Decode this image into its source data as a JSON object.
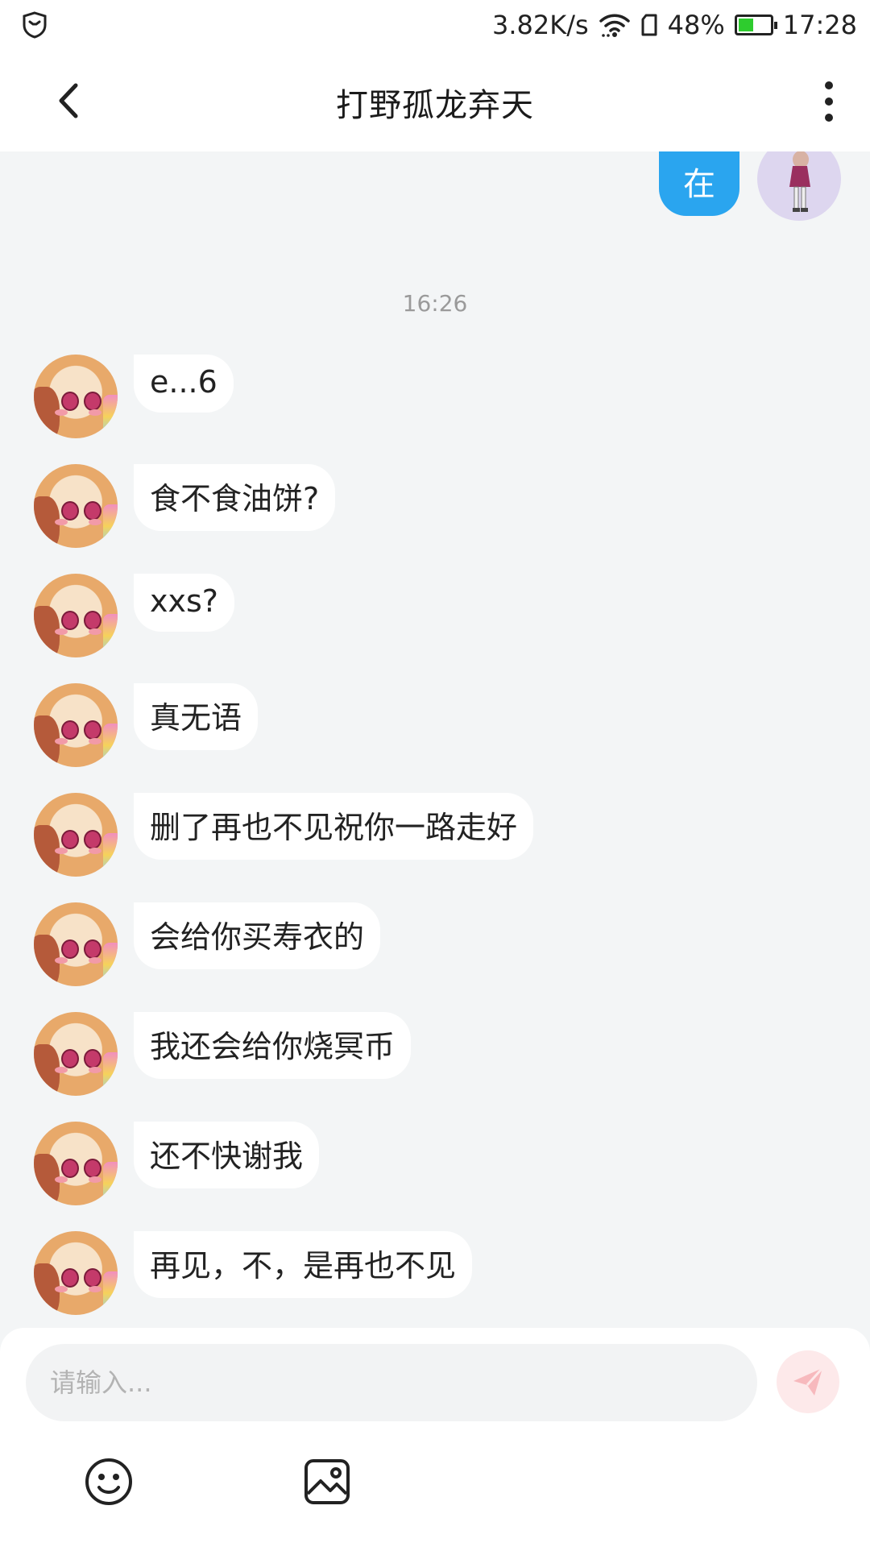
{
  "status_bar": {
    "net_speed": "3.82K/s",
    "battery_percent": "48%",
    "battery_level": 0.48,
    "time": "17:28",
    "icons": [
      "shield-icon",
      "wifi-icon",
      "sim-icon",
      "battery-icon"
    ]
  },
  "header": {
    "title": "打野孤龙弃天",
    "back_icon": "chevron-left-icon",
    "more_icon": "more-vertical-icon"
  },
  "chat": {
    "outgoing": {
      "text": "在"
    },
    "timestamp": "16:26",
    "incoming": [
      {
        "text": "e...6"
      },
      {
        "text": "食不食油饼?"
      },
      {
        "text": "xxs?"
      },
      {
        "text": "真无语"
      },
      {
        "text": "删了再也不见祝你一路走好"
      },
      {
        "text": "会给你买寿衣的"
      },
      {
        "text": "我还会给你烧冥币"
      },
      {
        "text": "还不快谢我"
      },
      {
        "text": "再见，不，是再也不见"
      }
    ]
  },
  "composer": {
    "placeholder": "请输入...",
    "value": "",
    "send_icon": "paper-plane-icon",
    "tools": [
      "emoji-icon",
      "image-icon"
    ]
  },
  "colors": {
    "accent": "#2aa5ef",
    "background": "#f3f5f6",
    "battery": "#2ecc2e",
    "send_disabled": "#fde9ea"
  }
}
